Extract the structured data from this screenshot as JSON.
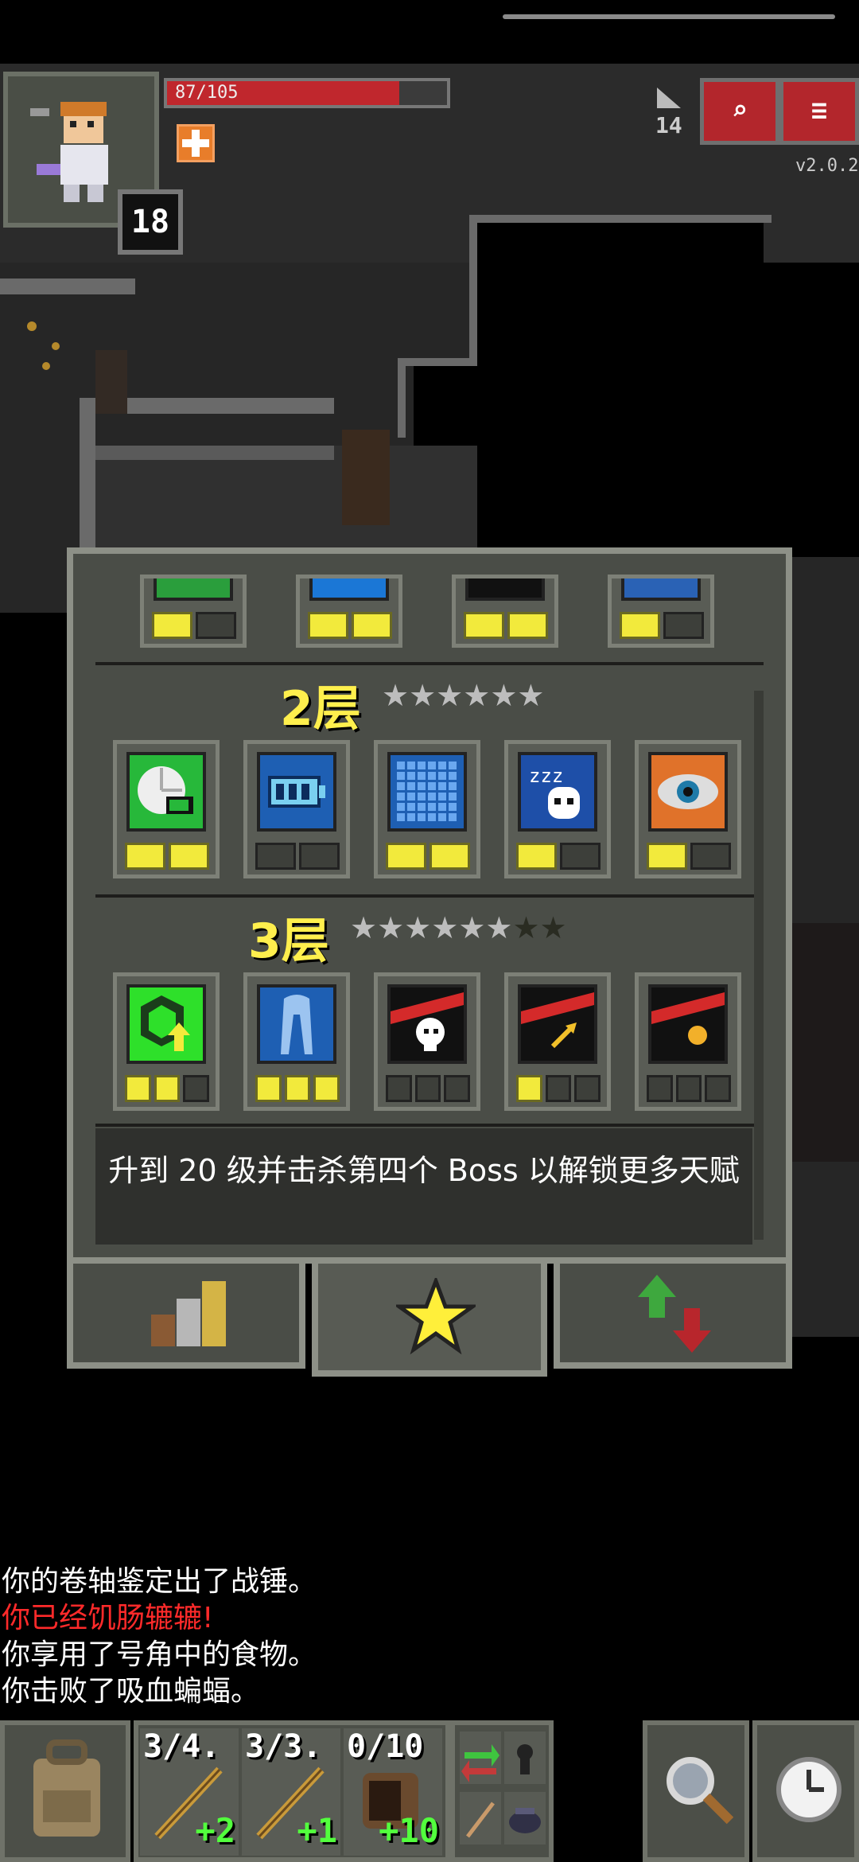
{
  "hero": {
    "hp_text": "87/105",
    "hp_fraction": 0.83,
    "level": "18",
    "depth": "14",
    "version": "v2.0.2"
  },
  "top_buttons": {
    "journal_label": "⌕",
    "menu_label": "≡"
  },
  "talents": {
    "tier1_partial": [
      {
        "icon": "hourglass-icon",
        "color": "#2a9e3c",
        "pips": [
          1,
          0
        ]
      },
      {
        "icon": "key-icon",
        "color": "#1b77d6",
        "pips": [
          1,
          1
        ]
      },
      {
        "icon": "dark-box-icon",
        "color": "#111111",
        "pips": [
          1,
          1
        ]
      },
      {
        "icon": "shield-icon",
        "color": "#2a62b5",
        "pips": [
          1,
          0
        ]
      }
    ],
    "tier2": {
      "title": "2层",
      "stars_lit": 6,
      "stars_total": 6,
      "items": [
        {
          "icon": "clock-battery-icon",
          "color": "#27b83a",
          "pips": [
            1,
            1
          ]
        },
        {
          "icon": "battery-icon",
          "color": "#1e5fb3",
          "pips": [
            0,
            0
          ]
        },
        {
          "icon": "grid-icon",
          "color": "#1e5fb3",
          "pips": [
            1,
            1
          ]
        },
        {
          "icon": "sleeping-ghost-icon",
          "color": "#1e4fa8",
          "pips": [
            1,
            0
          ]
        },
        {
          "icon": "eye-icon",
          "color": "#e0722a",
          "pips": [
            1,
            0
          ]
        }
      ]
    },
    "tier3": {
      "title": "3层",
      "stars_lit": 6,
      "stars_total": 8,
      "items": [
        {
          "icon": "green-hex-arrow-icon",
          "color": "#2ee02a",
          "pips": [
            1,
            1,
            0
          ]
        },
        {
          "icon": "cloak-icon",
          "color": "#1e5fb3",
          "pips": [
            1,
            1,
            1
          ]
        },
        {
          "icon": "skull-slash-icon",
          "color": "#111111",
          "pips": [
            0,
            0,
            0
          ]
        },
        {
          "icon": "arrow-slash-icon",
          "color": "#111111",
          "pips": [
            1,
            0,
            0
          ]
        },
        {
          "icon": "coin-slash-icon",
          "color": "#111111",
          "pips": [
            0,
            0,
            0
          ]
        }
      ]
    },
    "unlock_message": "升到 20 级并击杀第四个 Boss 以解锁更多天赋"
  },
  "tabs": [
    {
      "icon": "stats-bars-icon"
    },
    {
      "icon": "star-icon"
    },
    {
      "icon": "up-down-arrows-icon"
    }
  ],
  "log": [
    {
      "text": "你的卷轴鉴定出了战锤。",
      "color": "#ffffff"
    },
    {
      "text": "你已经饥肠辘辘!",
      "color": "#ff2a2a"
    },
    {
      "text": "你享用了号角中的食物。",
      "color": "#ffffff"
    },
    {
      "text": "你击败了吸血蝙蝠。",
      "color": "#ffffff"
    }
  ],
  "quickslots": [
    {
      "label": "3/4.",
      "plus": "+2",
      "icon": "wand-icon"
    },
    {
      "label": "3/3.",
      "plus": "+1",
      "icon": "wand-icon"
    },
    {
      "label": "0/10",
      "plus": "+10",
      "icon": "horn-icon"
    }
  ]
}
